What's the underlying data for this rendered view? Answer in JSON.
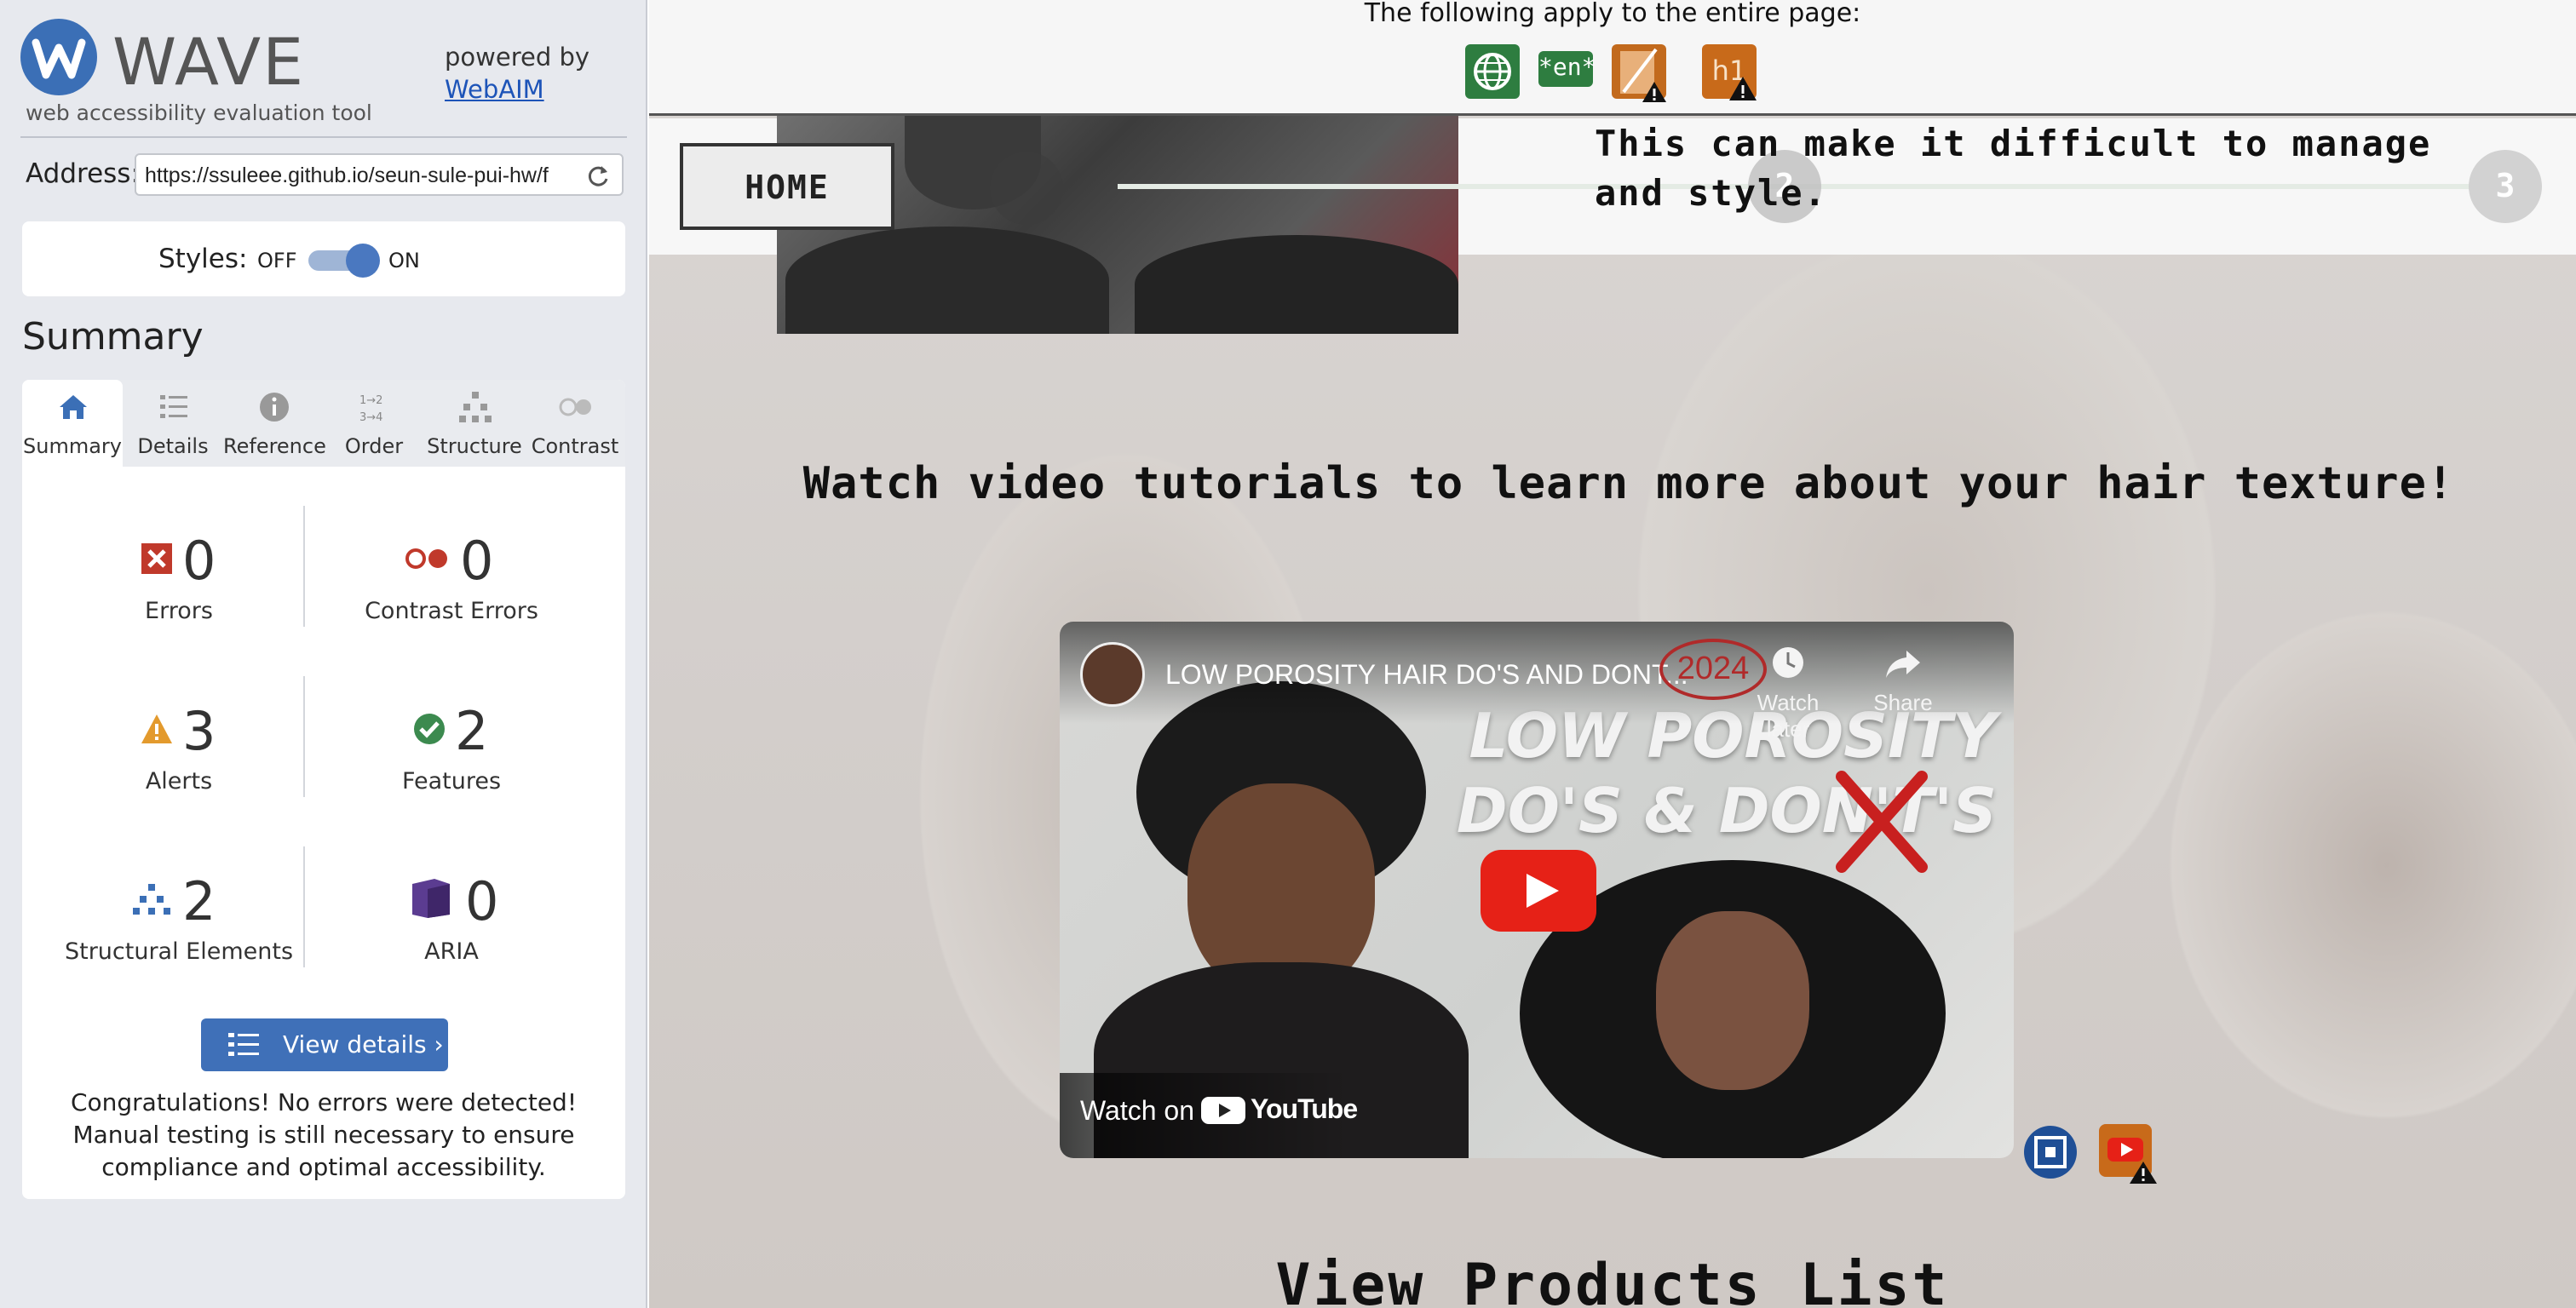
{
  "wave": {
    "logo_text": "WAVE",
    "tagline": "web accessibility evaluation tool",
    "powered_by": "powered by",
    "webaim_link": "WebAIM",
    "address_label": "Address:",
    "address_value": "https://ssuleee.github.io/seun-sule-pui-hw/f",
    "styles_label": "Styles:",
    "styles_off": "OFF",
    "styles_on": "ON",
    "summary_heading": "Summary",
    "tabs": [
      {
        "label": "Summary",
        "icon": "home-icon",
        "active": true
      },
      {
        "label": "Details",
        "icon": "list-icon"
      },
      {
        "label": "Reference",
        "icon": "info-icon"
      },
      {
        "label": "Order",
        "icon": "order-icon"
      },
      {
        "label": "Structure",
        "icon": "structure-icon"
      },
      {
        "label": "Contrast",
        "icon": "contrast-icon"
      }
    ],
    "stats": {
      "errors": {
        "count": "0",
        "label": "Errors"
      },
      "contrast_errors": {
        "count": "0",
        "label": "Contrast Errors"
      },
      "alerts": {
        "count": "3",
        "label": "Alerts"
      },
      "features": {
        "count": "2",
        "label": "Features"
      },
      "structural": {
        "count": "2",
        "label": "Structural Elements"
      },
      "aria": {
        "count": "0",
        "label": "ARIA"
      }
    },
    "view_details_label": "View details ›",
    "congrats": "Congratulations! No errors were detected! Manual testing is still necessary to ensure compliance and optimal accessibility.",
    "colors": {
      "brand": "#3b6fb6",
      "error": "#c0392b",
      "alert": "#e39a2d",
      "feature": "#3c8a4f",
      "aria": "#5b3c91"
    }
  },
  "page": {
    "banner_text": "The following apply to the entire page:",
    "banner_icons": [
      "language-icon",
      "lang-en-icon",
      "missing-title-alert-icon",
      "h1-alert-icon"
    ],
    "lang_text": "*en*",
    "h1_text": "h1",
    "home_button": "HOME",
    "steps": [
      "2",
      "3"
    ],
    "callout_text": "This can make it difficult to manage and style.",
    "video_heading": "Watch video tutorials to learn more about your hair texture!",
    "video": {
      "title": "LOW POROSITY HAIR DO'S AND DONT...",
      "big_title_line1": "LOW POROSITY",
      "big_title_line2": "DO'S & DON'T'S",
      "year_badge": "2024",
      "watch_later": "Watch later",
      "share": "Share",
      "watch_on": "Watch on",
      "youtube": "YouTube"
    },
    "products_heading": "View Products List"
  }
}
